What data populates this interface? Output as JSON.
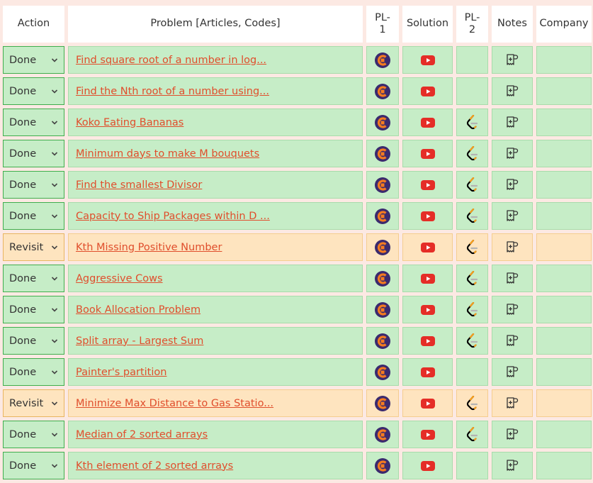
{
  "header": {
    "action": "Action",
    "problem": "Problem [Articles, Codes]",
    "pl1_line1": "PL-",
    "pl1_line2": "1",
    "solution": "Solution",
    "pl2_line1": "PL-",
    "pl2_line2": "2",
    "notes": "Notes",
    "company": "Company"
  },
  "icons": {
    "pl1": "codestudio-logo-icon",
    "solution": "youtube-play-icon",
    "pl2": "leetcode-logo-icon",
    "notes": "add-note-icon",
    "dropdown": "chevron-down-icon"
  },
  "colors": {
    "done_bg": "#c6edc7",
    "revisit_bg": "#fee4bf",
    "link": "#e04e2c"
  },
  "rows": [
    {
      "status": "Done",
      "problem": "Find square root of a number in log...",
      "has_pl2": false
    },
    {
      "status": "Done",
      "problem": "Find the Nth root of a number using...",
      "has_pl2": false
    },
    {
      "status": "Done",
      "problem": "Koko Eating Bananas",
      "has_pl2": true
    },
    {
      "status": "Done",
      "problem": "Minimum days to make M bouquets",
      "has_pl2": true
    },
    {
      "status": "Done",
      "problem": "Find the smallest Divisor",
      "has_pl2": true
    },
    {
      "status": "Done",
      "problem": "Capacity to Ship Packages within D ...",
      "has_pl2": true
    },
    {
      "status": "Revisit",
      "problem": "Kth Missing Positive Number",
      "has_pl2": true
    },
    {
      "status": "Done",
      "problem": "Aggressive Cows",
      "has_pl2": true
    },
    {
      "status": "Done",
      "problem": "Book Allocation Problem",
      "has_pl2": true
    },
    {
      "status": "Done",
      "problem": "Split array - Largest Sum",
      "has_pl2": true
    },
    {
      "status": "Done",
      "problem": "Painter's partition",
      "has_pl2": false
    },
    {
      "status": "Revisit",
      "problem": "Minimize Max Distance to Gas Statio...",
      "has_pl2": true
    },
    {
      "status": "Done",
      "problem": "Median of 2 sorted arrays",
      "has_pl2": true
    },
    {
      "status": "Done",
      "problem": "Kth element of 2 sorted arrays",
      "has_pl2": false
    }
  ]
}
